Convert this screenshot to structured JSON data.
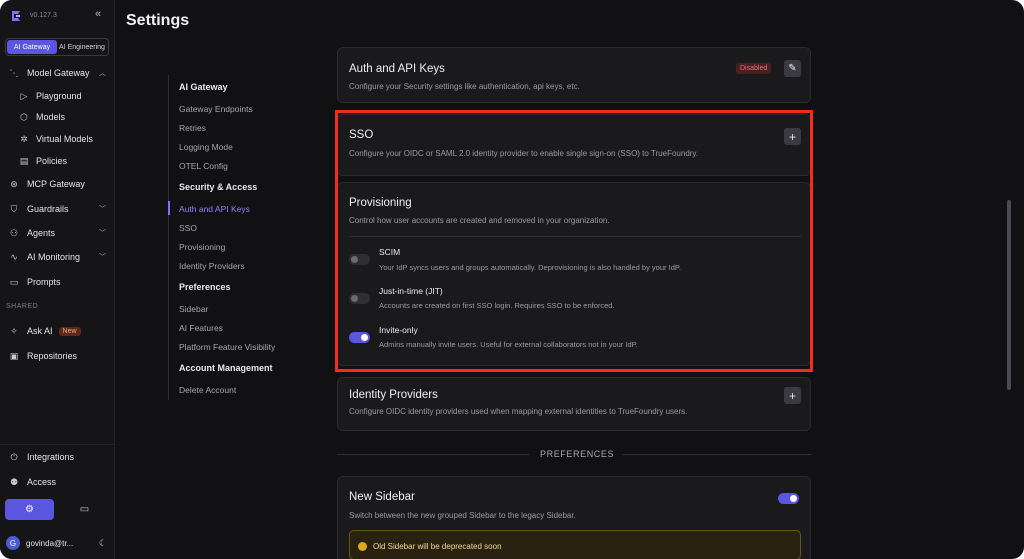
{
  "app": {
    "version": "v0.127.3",
    "colors": {
      "accent": "#5b56e0",
      "highlight": "#f52c1b",
      "disabled_badge": "#e57373"
    }
  },
  "sidebar": {
    "segment": [
      {
        "label": "AI Gateway",
        "active": true
      },
      {
        "label": "AI Engineering",
        "active": false
      }
    ],
    "items": [
      {
        "label": "Model Gateway",
        "icon": "gateway-icon"
      },
      {
        "label": "Playground",
        "icon": "play-icon"
      },
      {
        "label": "Models",
        "icon": "cube-icon"
      },
      {
        "label": "Virtual Models",
        "icon": "virtual-model-icon"
      },
      {
        "label": "Policies",
        "icon": "document-icon"
      },
      {
        "label": "MCP Gateway",
        "icon": "mcp-icon"
      },
      {
        "label": "Guardrails",
        "icon": "shield-icon"
      },
      {
        "label": "Agents",
        "icon": "agent-icon"
      },
      {
        "label": "AI Monitoring",
        "icon": "monitoring-icon"
      },
      {
        "label": "Prompts",
        "icon": "prompt-icon"
      }
    ],
    "shared_label": "SHARED",
    "shared_items": [
      {
        "label": "Ask AI",
        "icon": "sparkle-icon",
        "badge": "New"
      },
      {
        "label": "Repositories",
        "icon": "repository-icon"
      }
    ],
    "bottom_items": [
      {
        "label": "Integrations",
        "icon": "plug-icon"
      },
      {
        "label": "Access",
        "icon": "users-icon"
      }
    ],
    "user": {
      "initial": "G",
      "name": "govinda@tr..."
    }
  },
  "page": {
    "title": "Settings"
  },
  "subnav": {
    "items": [
      {
        "label": "AI Gateway",
        "type": "header"
      },
      {
        "label": "Gateway Endpoints"
      },
      {
        "label": "Retries"
      },
      {
        "label": "Logging Mode"
      },
      {
        "label": "OTEL Config"
      },
      {
        "label": "Security & Access",
        "type": "header"
      },
      {
        "label": "Auth and API Keys",
        "active": true
      },
      {
        "label": "SSO"
      },
      {
        "label": "Provisioning"
      },
      {
        "label": "Identity Providers"
      },
      {
        "label": "Preferences",
        "type": "header"
      },
      {
        "label": "Sidebar"
      },
      {
        "label": "AI Features"
      },
      {
        "label": "Platform Feature Visibility"
      },
      {
        "label": "Account Management",
        "type": "header"
      },
      {
        "label": "Delete Account"
      }
    ]
  },
  "auth": {
    "title": "Auth and API Keys",
    "description": "Configure your Security settings like authentication, api keys, etc.",
    "status": "Disabled"
  },
  "sso": {
    "title": "SSO",
    "description": "Configure your OIDC or SAML 2.0 identity provider to enable single sign-on (SSO) to TrueFoundry."
  },
  "provisioning": {
    "title": "Provisioning",
    "description": "Control how user accounts are created and removed in your organization.",
    "options": [
      {
        "title": "SCIM",
        "description": "Your IdP syncs users and groups automatically. Deprovisioning is also handled by your IdP.",
        "enabled": false
      },
      {
        "title": "Just-in-time (JIT)",
        "description": "Accounts are created on first SSO login. Requires SSO to be enforced.",
        "enabled": false
      },
      {
        "title": "Invite-only",
        "description": "Admins manually invite users. Useful for external collaborators not in your IdP.",
        "enabled": true
      }
    ]
  },
  "identity_providers": {
    "title": "Identity Providers",
    "description": "Configure OIDC identity providers used when mapping external identities to TrueFoundry users."
  },
  "preferences": {
    "section_label": "PREFERENCES",
    "new_sidebar": {
      "title": "New Sidebar",
      "description": "Switch between the new grouped Sidebar to the legacy Sidebar.",
      "enabled": true,
      "warning": "Old Sidebar will be deprecated soon"
    }
  }
}
